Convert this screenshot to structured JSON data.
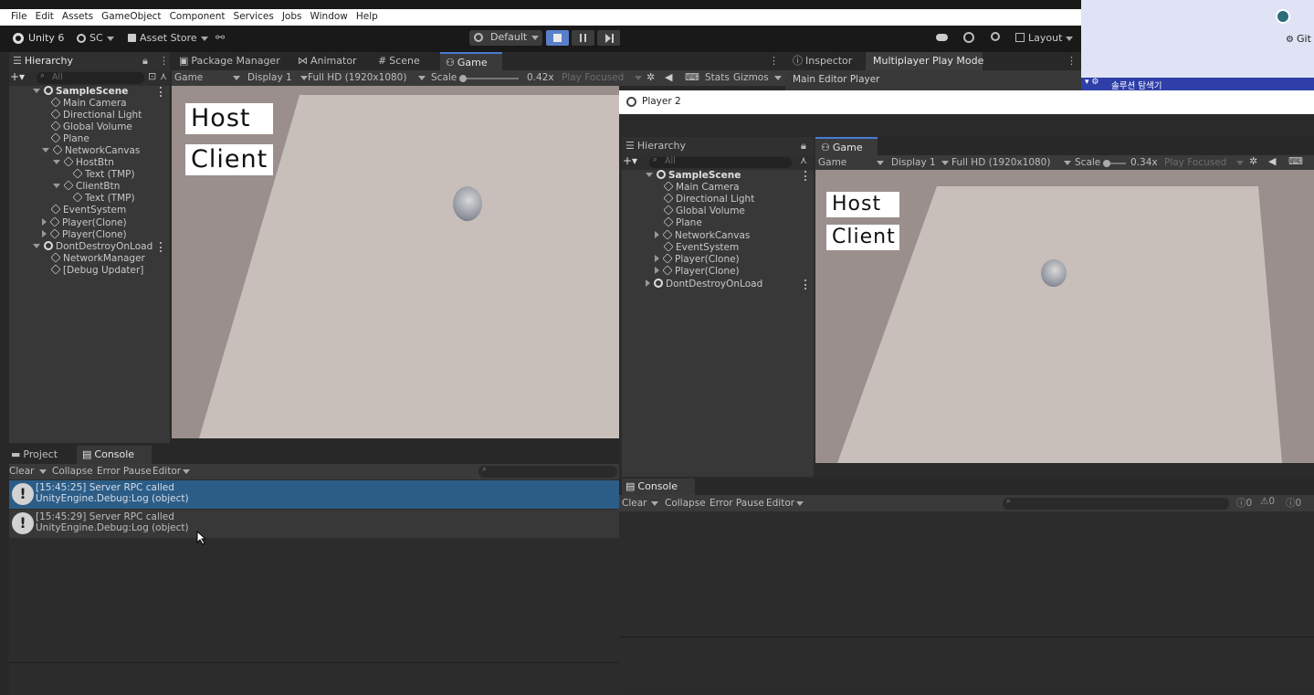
{
  "menubar": {
    "items": [
      "File",
      "Edit",
      "Assets",
      "GameObject",
      "Component",
      "Services",
      "Jobs",
      "Window",
      "Help"
    ]
  },
  "toolbar": {
    "unity_label": "Unity 6",
    "account": "SC",
    "asset_store": "Asset Store",
    "layout_preset": "Default",
    "layout": "Layout"
  },
  "left_tabs": {
    "hierarchy": "Hierarchy",
    "package_manager": "Package Manager",
    "animator": "Animator",
    "scene": "Scene",
    "game": "Game",
    "inspector": "Inspector",
    "multiplayer": "Multiplayer Play Mode"
  },
  "hierarchy": {
    "search_placeholder": "All",
    "items": [
      {
        "label": "SampleScene"
      },
      {
        "label": "Main Camera"
      },
      {
        "label": "Directional Light"
      },
      {
        "label": "Global Volume"
      },
      {
        "label": "Plane"
      },
      {
        "label": "NetworkCanvas"
      },
      {
        "label": "HostBtn"
      },
      {
        "label": "Text (TMP)"
      },
      {
        "label": "ClientBtn"
      },
      {
        "label": "Text (TMP)"
      },
      {
        "label": "EventSystem"
      },
      {
        "label": "Player(Clone)"
      },
      {
        "label": "Player(Clone)"
      },
      {
        "label": "DontDestroyOnLoad"
      },
      {
        "label": "NetworkManager"
      },
      {
        "label": "[Debug Updater]"
      }
    ]
  },
  "game_toolbar": {
    "mode": "Game",
    "display": "Display 1",
    "resolution": "Full HD (1920x1080)",
    "scale_label": "Scale",
    "scale_value": "0.42x",
    "play_focused": "Play Focused",
    "stats": "Stats",
    "gizmos": "Gizmos"
  },
  "game_view": {
    "host_btn": "Host",
    "client_btn": "Client"
  },
  "inspector": {
    "main_editor_player": "Main Editor Player"
  },
  "bottom_tabs": {
    "project": "Project",
    "console": "Console"
  },
  "console": {
    "clear": "Clear",
    "collapse": "Collapse",
    "error_pause": "Error Pause",
    "editor": "Editor",
    "logs": [
      {
        "line1": "[15:45:25] Server RPC called",
        "line2": "UnityEngine.Debug:Log (object)"
      },
      {
        "line1": "[15:45:29] Server RPC called",
        "line2": "UnityEngine.Debug:Log (object)"
      }
    ]
  },
  "player2": {
    "title": "Player 2",
    "hierarchy_tab": "Hierarchy",
    "game_tab": "Game",
    "search_placeholder": "All",
    "hierarchy_items": [
      {
        "label": "SampleScene"
      },
      {
        "label": "Main Camera"
      },
      {
        "label": "Directional Light"
      },
      {
        "label": "Global Volume"
      },
      {
        "label": "Plane"
      },
      {
        "label": "NetworkCanvas"
      },
      {
        "label": "EventSystem"
      },
      {
        "label": "Player(Clone)"
      },
      {
        "label": "Player(Clone)"
      },
      {
        "label": "DontDestroyOnLoad"
      }
    ],
    "game_toolbar": {
      "mode": "Game",
      "display": "Display 1",
      "resolution": "Full HD (1920x1080)",
      "scale_label": "Scale",
      "scale_value": "0.34x",
      "play_focused": "Play Focused"
    },
    "host_btn": "Host",
    "client_btn": "Client",
    "console_tab": "Console",
    "console": {
      "clear": "Clear",
      "collapse": "Collapse",
      "error_pause": "Error Pause",
      "editor": "Editor",
      "count_info": "0",
      "count_warn": "0",
      "count_err": "0"
    }
  },
  "right_panel": {
    "git_label": "Git",
    "explorer": "솔루션 탐색기"
  },
  "colors": {
    "accent": "#4b7bd6",
    "selected_row": "#2c5d87",
    "game_bg": "#9a8f8c",
    "plane": "#c8bfbb"
  }
}
